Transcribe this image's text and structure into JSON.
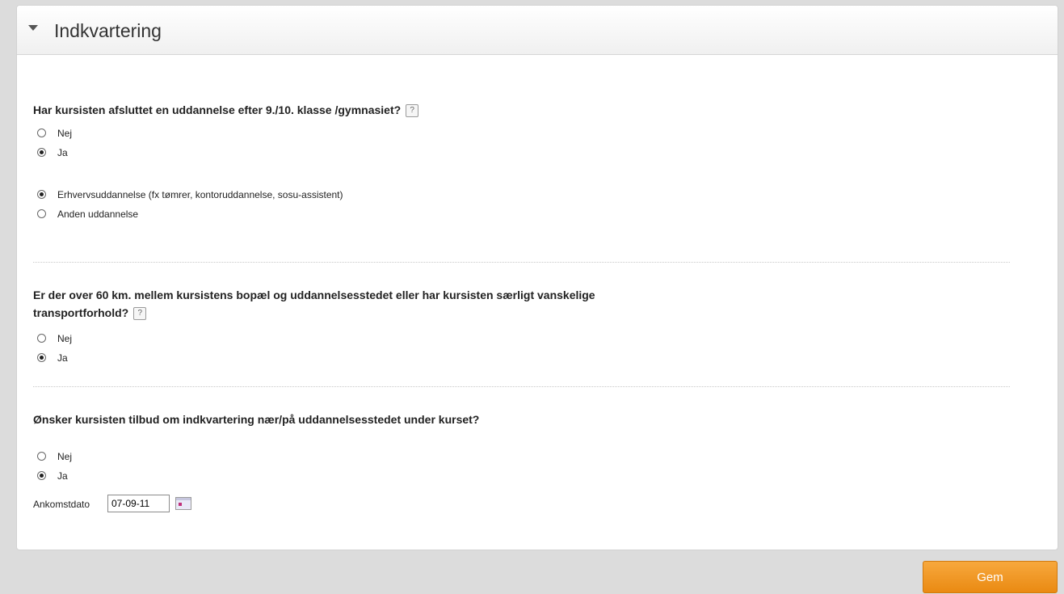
{
  "panel": {
    "title": "Indkvartering"
  },
  "q1": {
    "text": "Har kursisten afsluttet en uddannelse efter 9./10. klasse /gymnasiet?",
    "help": "?",
    "options": [
      "Nej",
      "Ja"
    ],
    "selected": "Ja",
    "sub_options": [
      "Erhvervsuddannelse (fx tømrer, kontoruddannelse, sosu-assistent)",
      "Anden uddannelse"
    ],
    "sub_selected": "Erhvervsuddannelse (fx tømrer, kontoruddannelse, sosu-assistent)"
  },
  "q2": {
    "text_line1": "Er der over 60 km. mellem kursistens bopæl og uddannelsesstedet eller har kursisten særligt vanskelige",
    "text_line2": "transportforhold?",
    "help": "?",
    "options": [
      "Nej",
      "Ja"
    ],
    "selected": "Ja"
  },
  "q3": {
    "text": "Ønsker kursisten tilbud om indkvartering nær/på uddannelsesstedet under kurset?",
    "options": [
      "Nej",
      "Ja"
    ],
    "selected": "Ja",
    "date_label": "Ankomstdato",
    "date_value": "07-09-11"
  },
  "footer": {
    "save_label": "Gem"
  },
  "colors": {
    "accent": "#ea8a12",
    "background": "#dcdcdc"
  },
  "icons": {
    "collapse": "caret-down-icon",
    "help": "help-icon",
    "calendar": "calendar-icon"
  }
}
